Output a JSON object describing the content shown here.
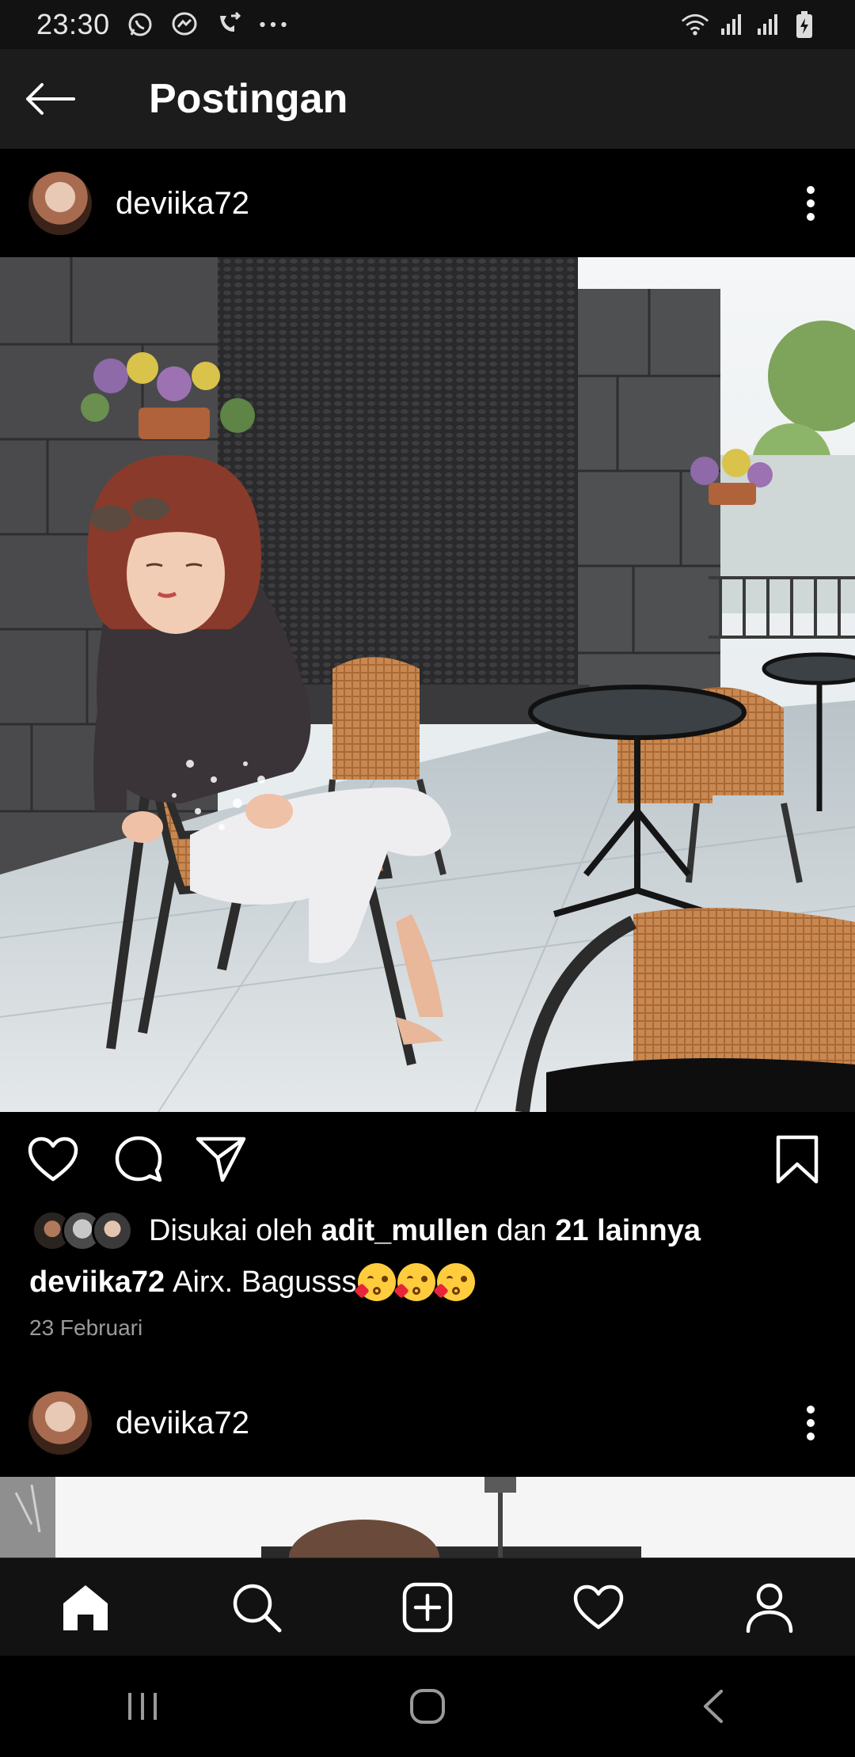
{
  "status_bar": {
    "time": "23:30",
    "left_icons": [
      "whatsapp-icon",
      "messenger-icon",
      "call-forward-icon",
      "more-dots-icon"
    ],
    "right_icons": [
      "wifi-icon",
      "signal-icon",
      "signal-icon",
      "battery-charging-icon"
    ]
  },
  "app_bar": {
    "title": "Postingan",
    "back_icon": "arrow-left-icon"
  },
  "post": {
    "username": "deviika72",
    "likes": {
      "prefix": "Disukai oleh",
      "liker": "adit_mullen",
      "joiner": "dan",
      "others": "21 lainnya"
    },
    "caption_user": "deviika72",
    "caption_text": "Airx. Bagusss",
    "caption_emoji": "face-blowing-kiss",
    "date": "23 Februari"
  },
  "next_post": {
    "username": "deviika72"
  },
  "bottom_nav": [
    "home-icon",
    "search-icon",
    "add-icon",
    "activity-heart-icon",
    "profile-icon"
  ],
  "system_nav": [
    "recents-icon",
    "home-circle-icon",
    "back-chevron-icon"
  ]
}
